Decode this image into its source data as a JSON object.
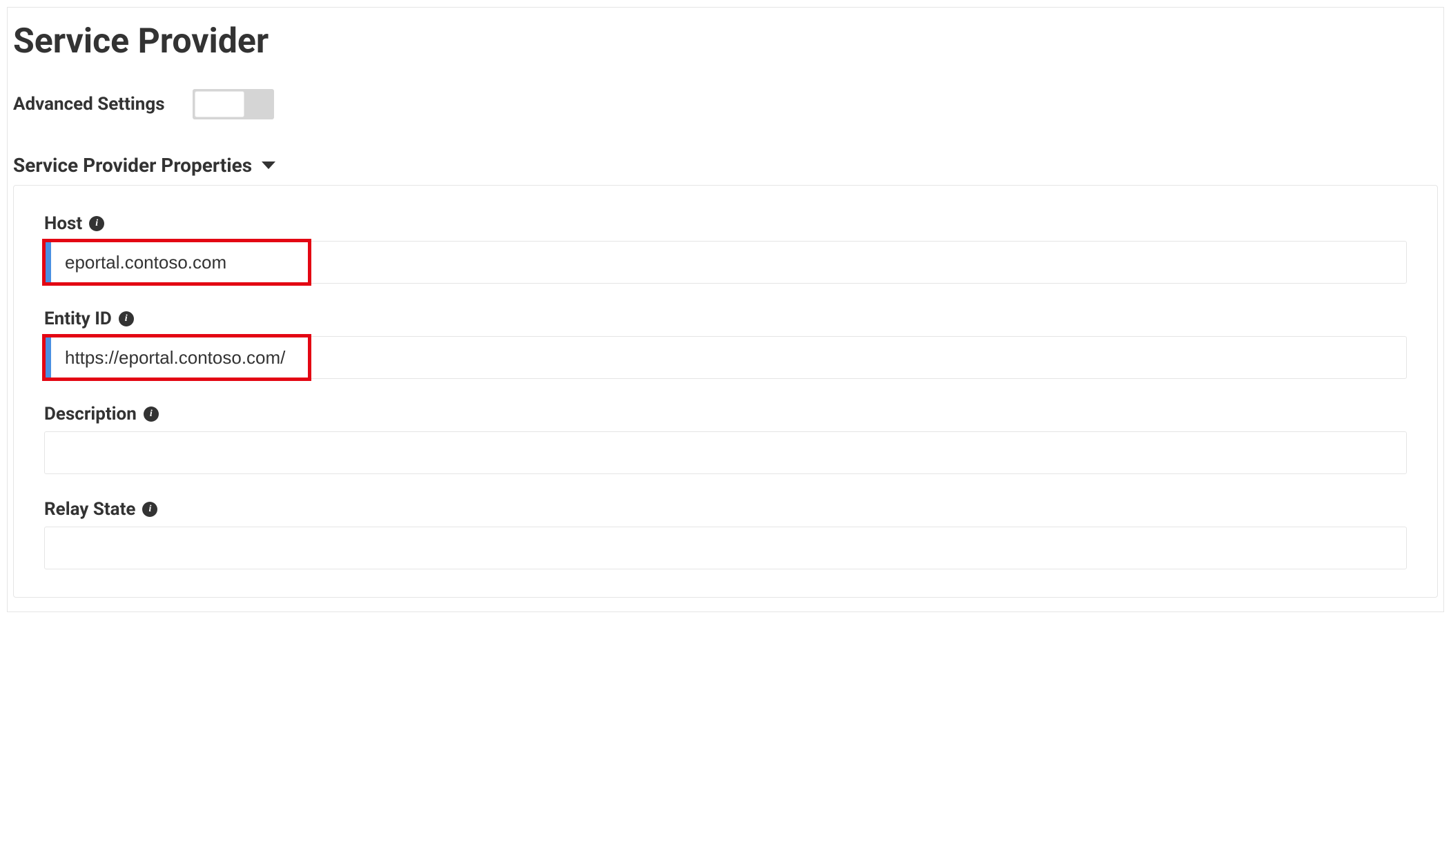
{
  "header": {
    "title": "Service Provider"
  },
  "advanced": {
    "label": "Advanced Settings",
    "enabled": false
  },
  "section": {
    "title": "Service Provider Properties"
  },
  "fields": {
    "host": {
      "label": "Host",
      "value": "eportal.contoso.com"
    },
    "entityId": {
      "label": "Entity ID",
      "value": "https://eportal.contoso.com/"
    },
    "description": {
      "label": "Description",
      "value": ""
    },
    "relayState": {
      "label": "Relay State",
      "value": ""
    }
  }
}
